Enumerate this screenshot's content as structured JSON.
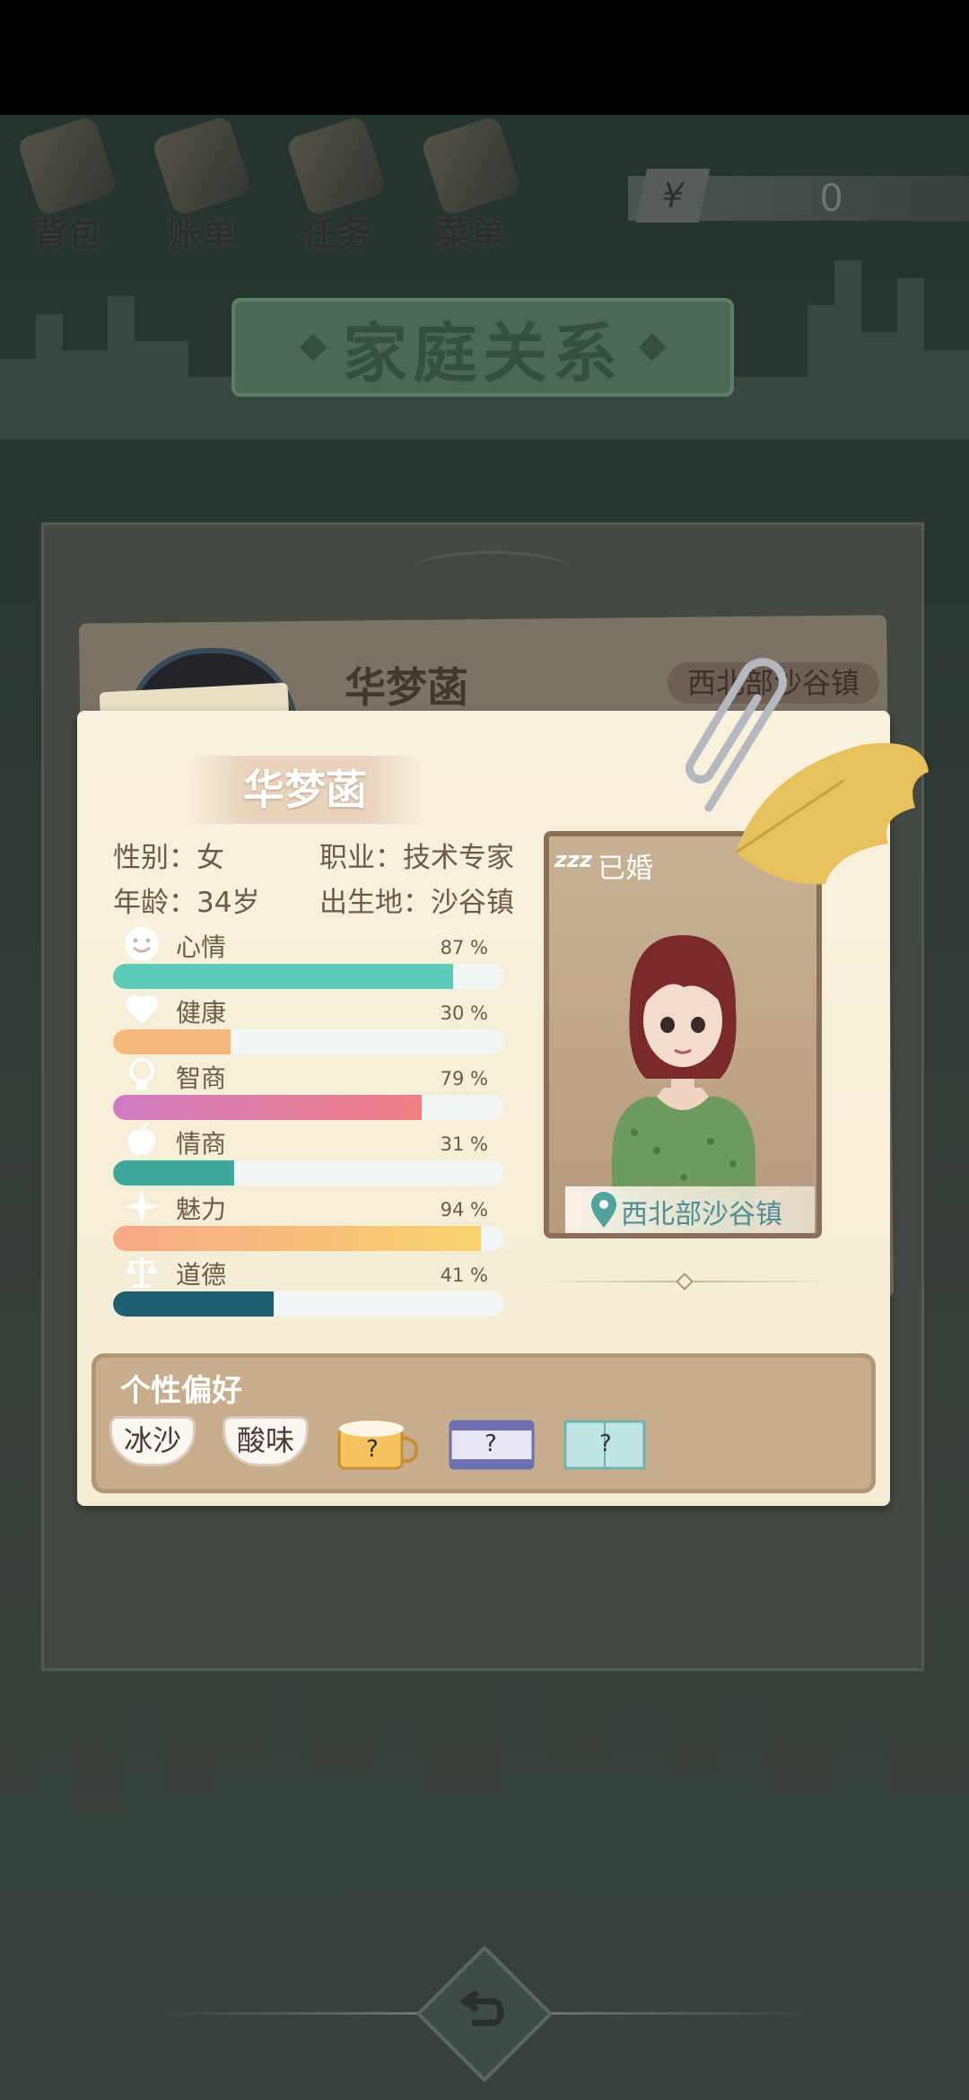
{
  "nav": {
    "bag": "背包",
    "bill": "账单",
    "task": "任务",
    "menu": "菜单"
  },
  "money": {
    "symbol": "¥",
    "amount": "0"
  },
  "banner": {
    "title": "家庭关系"
  },
  "back_card": {
    "name": "华梦菡",
    "location": "西北部沙谷镇"
  },
  "profile": {
    "name": "华梦菡",
    "gender_label": "性别：女",
    "job_label": "职业：技术专家",
    "age_label": "年龄：34岁",
    "birthplace_label": "出生地：沙谷镇",
    "sleep_icon": "zzz",
    "marital_status": "已婚",
    "location": "西北部沙谷镇"
  },
  "stats": [
    {
      "name": "心情",
      "value": 87,
      "value_text": "87 %",
      "icon": "smiley-icon",
      "color": "#5cc9b9"
    },
    {
      "name": "健康",
      "value": 30,
      "value_text": "30 %",
      "icon": "heart-icon",
      "color": "#f6b77d"
    },
    {
      "name": "智商",
      "value": 79,
      "value_text": "79 %",
      "icon": "lightbulb-icon",
      "color": "#e07891"
    },
    {
      "name": "情商",
      "value": 31,
      "value_text": "31 %",
      "icon": "apple-icon",
      "color": "#3fa89c"
    },
    {
      "name": "魅力",
      "value": 94,
      "value_text": "94 %",
      "icon": "sparkle-icon",
      "color": "#f7c97a"
    },
    {
      "name": "道德",
      "value": 41,
      "value_text": "41 %",
      "icon": "scales-icon",
      "color": "#1f5f73"
    }
  ],
  "preferences": {
    "title": "个性偏好",
    "items": [
      {
        "label": "冰沙",
        "icon": "cup-icon"
      },
      {
        "label": "酸味",
        "icon": "cup-icon"
      },
      {
        "label": "?",
        "icon": "beer-mug-icon"
      },
      {
        "label": "?",
        "icon": "film-icon"
      },
      {
        "label": "?",
        "icon": "book-icon"
      }
    ]
  },
  "colors": {
    "card_bg": "#f6eed7",
    "text_brown": "#6f5a47",
    "banner_green": "#4a6a55"
  }
}
